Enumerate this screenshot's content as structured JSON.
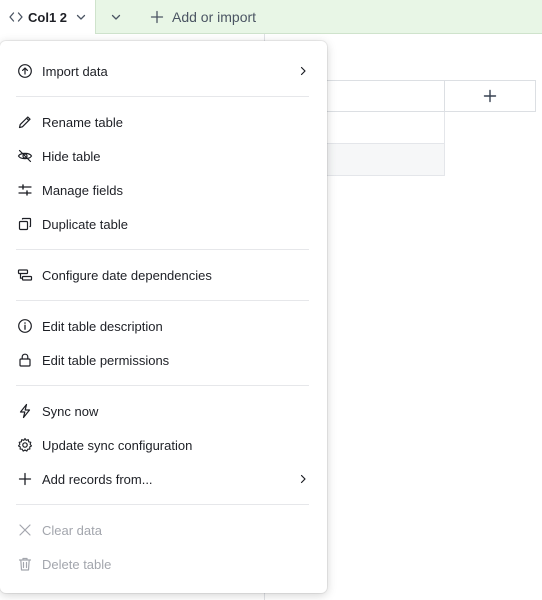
{
  "tabbar": {
    "active_tab_label": "Col1 2",
    "add_import_label": "Add or import"
  },
  "menu": {
    "items": [
      {
        "label": "Import data",
        "icon": "arrow-up-circle-icon",
        "submenu": true,
        "enabled": true
      },
      {
        "label": "Rename table",
        "icon": "pencil-icon",
        "submenu": false,
        "enabled": true
      },
      {
        "label": "Hide table",
        "icon": "eye-slash-icon",
        "submenu": false,
        "enabled": true
      },
      {
        "label": "Manage fields",
        "icon": "sliders-icon",
        "submenu": false,
        "enabled": true
      },
      {
        "label": "Duplicate table",
        "icon": "copy-icon",
        "submenu": false,
        "enabled": true
      },
      {
        "label": "Configure date dependencies",
        "icon": "date-dependencies-icon",
        "submenu": false,
        "enabled": true
      },
      {
        "label": "Edit table description",
        "icon": "info-icon",
        "submenu": false,
        "enabled": true
      },
      {
        "label": "Edit table permissions",
        "icon": "lock-icon",
        "submenu": false,
        "enabled": true
      },
      {
        "label": "Sync now",
        "icon": "lightning-icon",
        "submenu": false,
        "enabled": true
      },
      {
        "label": "Update sync configuration",
        "icon": "gear-icon",
        "submenu": false,
        "enabled": true
      },
      {
        "label": "Add records from...",
        "icon": "plus-icon",
        "submenu": true,
        "enabled": true
      },
      {
        "label": "Clear data",
        "icon": "x-icon",
        "submenu": false,
        "enabled": false
      },
      {
        "label": "Delete table",
        "icon": "trash-icon",
        "submenu": false,
        "enabled": false
      }
    ]
  },
  "colors": {
    "tabbar_bg": "#e8f6e6",
    "text": "#1d1f25",
    "disabled_text": "#a3a6ad"
  }
}
